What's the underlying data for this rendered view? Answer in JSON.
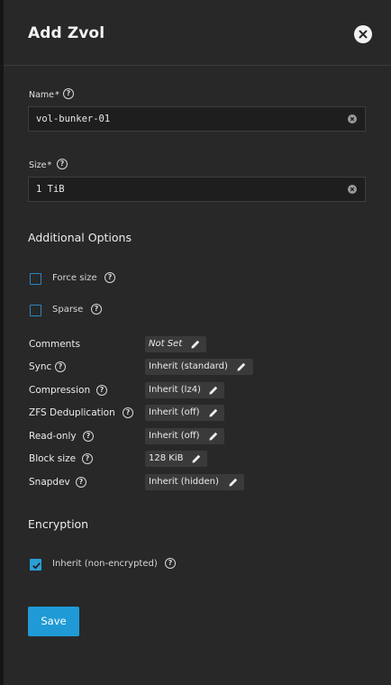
{
  "dialog": {
    "title": "Add Zvol",
    "close_icon": "close-icon"
  },
  "fields": {
    "name": {
      "label": "Name",
      "required_mark": "*",
      "value": "vol-bunker-01"
    },
    "size": {
      "label": "Size",
      "required_mark": "*",
      "value": "1 TiB"
    }
  },
  "additional_options": {
    "heading": "Additional Options",
    "force_size": {
      "label": "Force size",
      "checked": false
    },
    "sparse": {
      "label": "Sparse",
      "checked": false
    }
  },
  "properties": [
    {
      "label": "Comments",
      "value": "Not Set",
      "help": false,
      "italic": true
    },
    {
      "label": "Sync",
      "value": "Inherit (standard)",
      "help": true
    },
    {
      "label": "Compression",
      "value": "Inherit (lz4)",
      "help": true
    },
    {
      "label": "ZFS Deduplication",
      "value": "Inherit (off)",
      "help": true
    },
    {
      "label": "Read-only",
      "value": "Inherit (off)",
      "help": true
    },
    {
      "label": "Block size",
      "value": "128 KiB",
      "help": true
    },
    {
      "label": "Snapdev",
      "value": "Inherit (hidden)",
      "help": true
    }
  ],
  "encryption": {
    "heading": "Encryption",
    "inherit": {
      "label": "Inherit (non-encrypted)",
      "checked": true
    }
  },
  "actions": {
    "save_label": "Save"
  },
  "colors": {
    "accent": "#1f9ad6",
    "panel": "#282828",
    "chip": "#3a3a3a"
  }
}
